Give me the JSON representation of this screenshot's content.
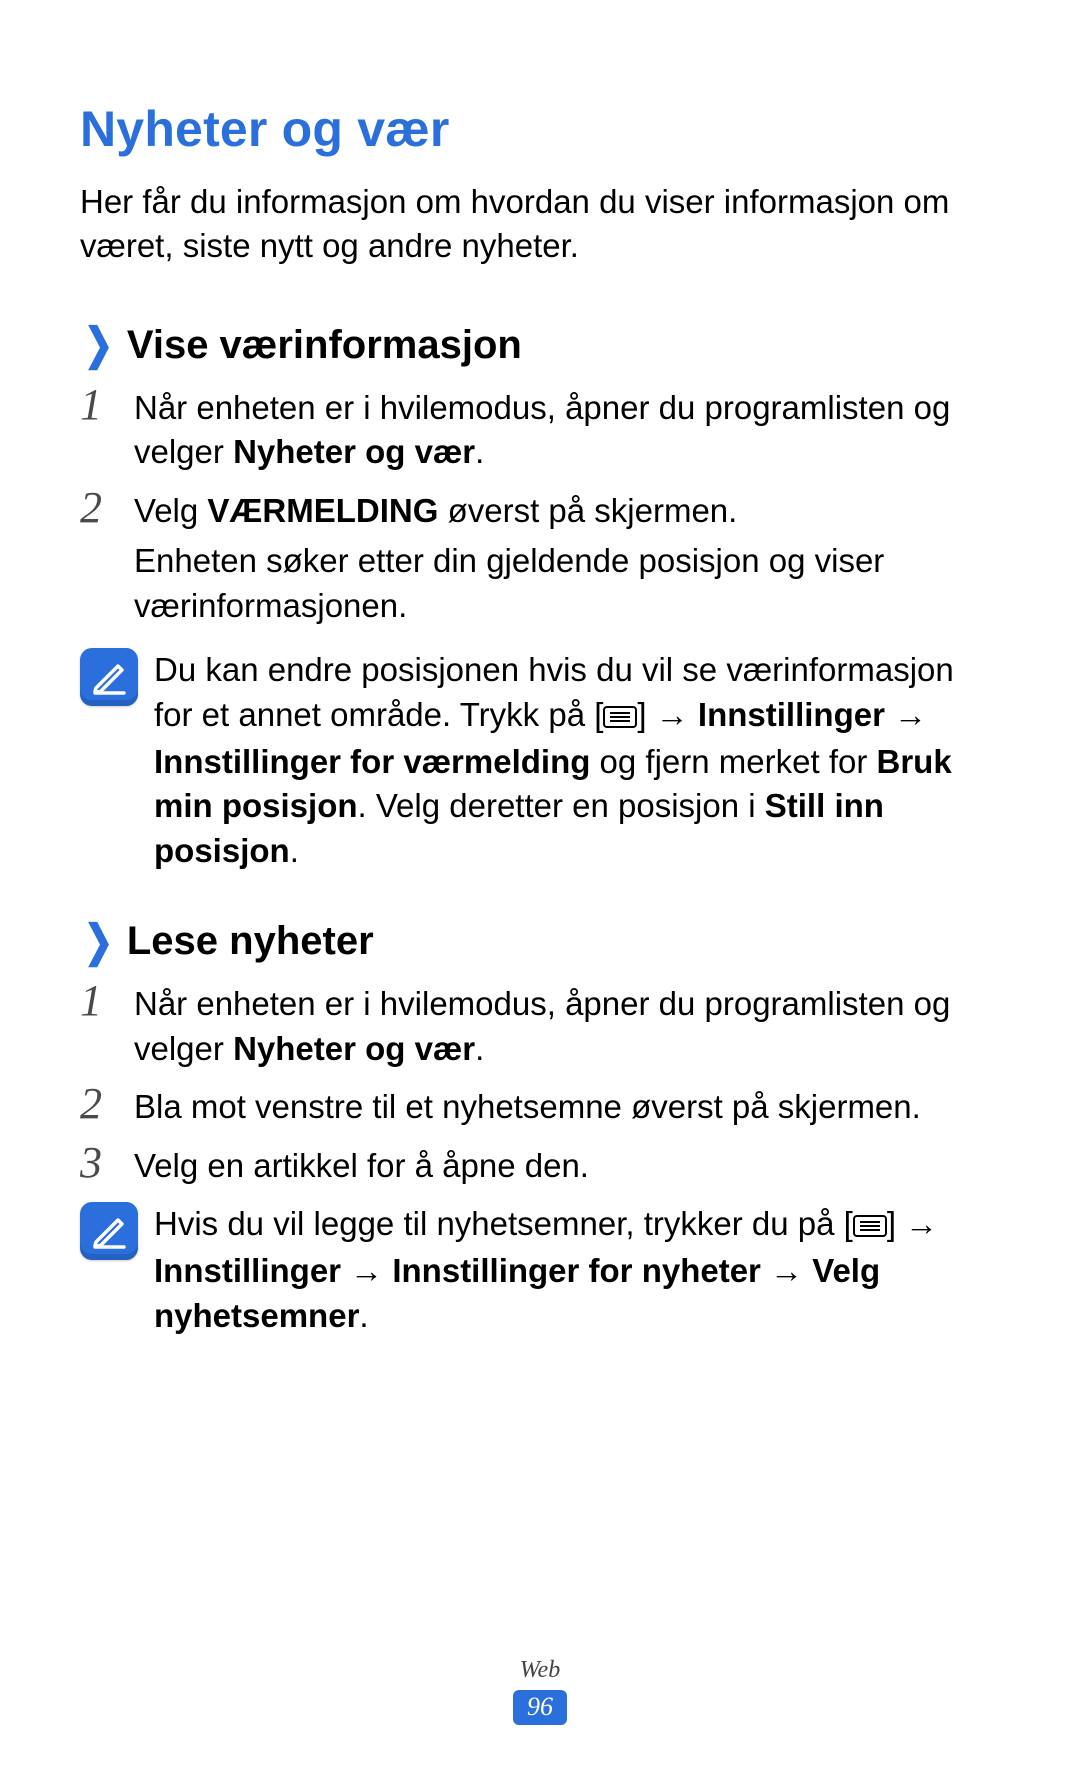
{
  "title": "Nyheter og vær",
  "intro": "Her får du informasjon om hvordan du viser informasjon om været, siste nytt og andre nyheter.",
  "section1": {
    "heading": "Vise værinformasjon",
    "step1_pre": "Når enheten er i hvilemodus, åpner du programlisten og velger ",
    "step1_bold": "Nyheter og vær",
    "step1_post": ".",
    "step2_pre": "Velg ",
    "step2_bold": "VÆRMELDING",
    "step2_post": " øverst på skjermen.",
    "step2_para2": "Enheten søker etter din gjeldende posisjon og viser værinformasjonen.",
    "note_pre": "Du kan endre posisjonen hvis du vil se værinformasjon for et annet område. Trykk på [",
    "note_mid1": "] → ",
    "note_b1": "Innstillinger",
    "note_arrow": " → ",
    "note_b2": "Innstillinger for værmelding",
    "note_mid2": " og fjern merket for ",
    "note_b3": "Bruk min posisjon",
    "note_mid3": ". Velg deretter en posisjon i ",
    "note_b4": "Still inn posisjon",
    "note_post": "."
  },
  "section2": {
    "heading": "Lese nyheter",
    "step1_pre": "Når enheten er i hvilemodus, åpner du programlisten og velger ",
    "step1_bold": "Nyheter og vær",
    "step1_post": ".",
    "step2": "Bla mot venstre til et nyhetsemne øverst på skjermen.",
    "step3": "Velg en artikkel for å åpne den.",
    "note_pre": "Hvis du vil legge til nyhetsemner, trykker du på [",
    "note_mid1": "] → ",
    "note_b1": "Innstillinger",
    "note_arrow": " → ",
    "note_b2": "Innstillinger for nyheter",
    "note_arrow2": " → ",
    "note_b3": "Velg nyhetsemner",
    "note_post": "."
  },
  "nums": {
    "n1": "1",
    "n2": "2",
    "n3": "3"
  },
  "footer": {
    "section": "Web",
    "page": "96"
  }
}
